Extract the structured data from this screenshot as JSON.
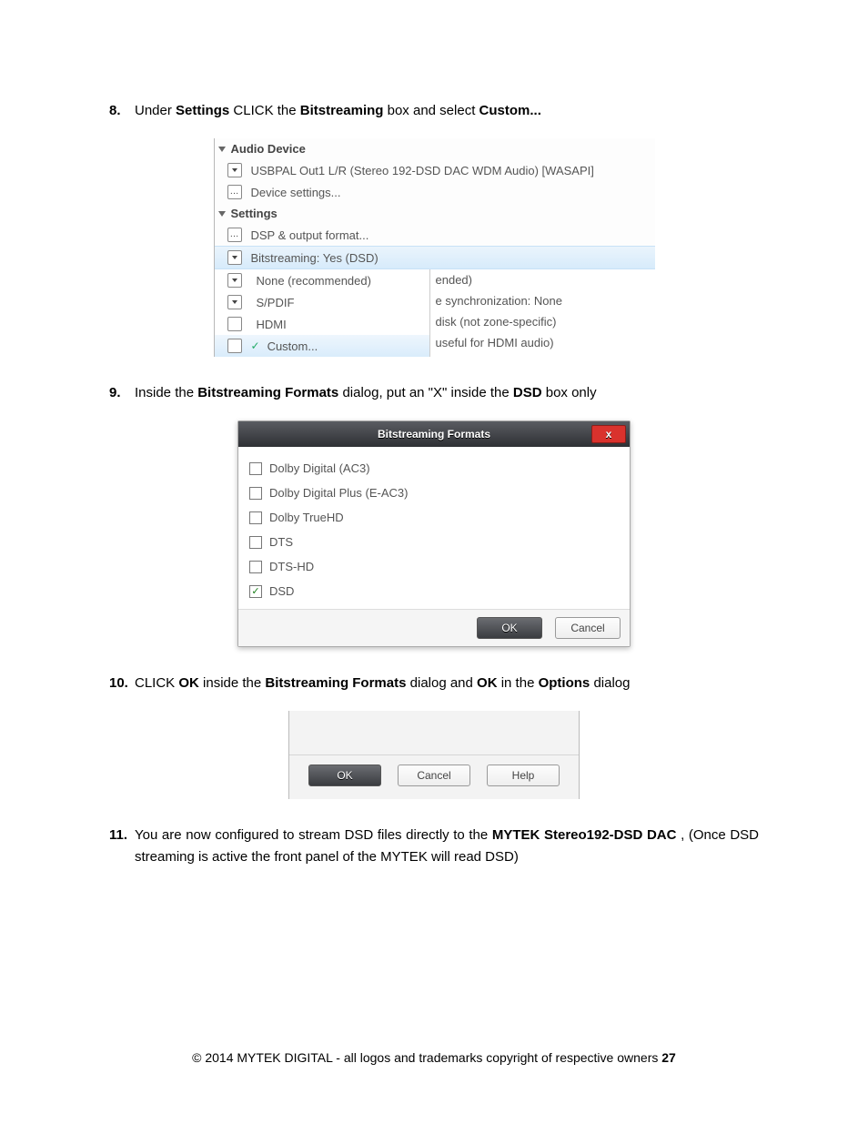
{
  "steps": {
    "s8": {
      "num": "8.",
      "t1": "Under ",
      "b1": "Settings",
      "t2": " CLICK the ",
      "b2": "Bitstreaming",
      "t3": " box and select ",
      "b3": "Custom..."
    },
    "s9": {
      "num": "9.",
      "t1": "Inside the ",
      "b1": "Bitstreaming Formats",
      "t2": " dialog, put an \"X\" inside the ",
      "b2": "DSD",
      "t3": " box only"
    },
    "s10": {
      "num": "10.",
      "t1": "CLICK ",
      "b1": "OK",
      "t2": " inside the ",
      "b2": "Bitstreaming Formats",
      "t3": " dialog and ",
      "b3": "OK",
      "t4": " in the ",
      "b4": "Options",
      "t5": " dialog"
    },
    "s11": {
      "num": "11.",
      "t1": "You are now configured to stream DSD files directly to the ",
      "b1": "MYTEK Stereo192-DSD DAC",
      "t2": " , (Once DSD streaming is active the front panel of the MYTEK will read DSD)"
    }
  },
  "panel1": {
    "section1": "Audio Device",
    "device": "USBPAL Out1 L/R (Stereo 192-DSD DAC WDM Audio) [WASAPI]",
    "deviceSettings": "Device settings...",
    "section2": "Settings",
    "dsp": "DSP & output format...",
    "bitstreaming": "Bitstreaming: Yes (DSD)",
    "menu": {
      "none": "None (recommended)",
      "spdif": "S/PDIF",
      "hdmi": "HDMI",
      "custom": "Custom..."
    },
    "right": {
      "r1": "ended)",
      "r2": "e synchronization: None",
      "r3": "disk (not zone-specific)",
      "r4": "useful for HDMI audio)"
    }
  },
  "dialog2": {
    "title": "Bitstreaming Formats",
    "close": "x",
    "items": {
      "ac3": "Dolby Digital (AC3)",
      "eac3": "Dolby Digital Plus (E-AC3)",
      "truehd": "Dolby TrueHD",
      "dts": "DTS",
      "dtshd": "DTS-HD",
      "dsd": "DSD"
    },
    "ok": "OK",
    "cancel": "Cancel"
  },
  "strip3": {
    "ok": "OK",
    "cancel": "Cancel",
    "help": "Help"
  },
  "footer": {
    "text": "© 2014 MYTEK DIGITAL - all logos and trademarks copyright of respective owners  ",
    "page": "27"
  }
}
